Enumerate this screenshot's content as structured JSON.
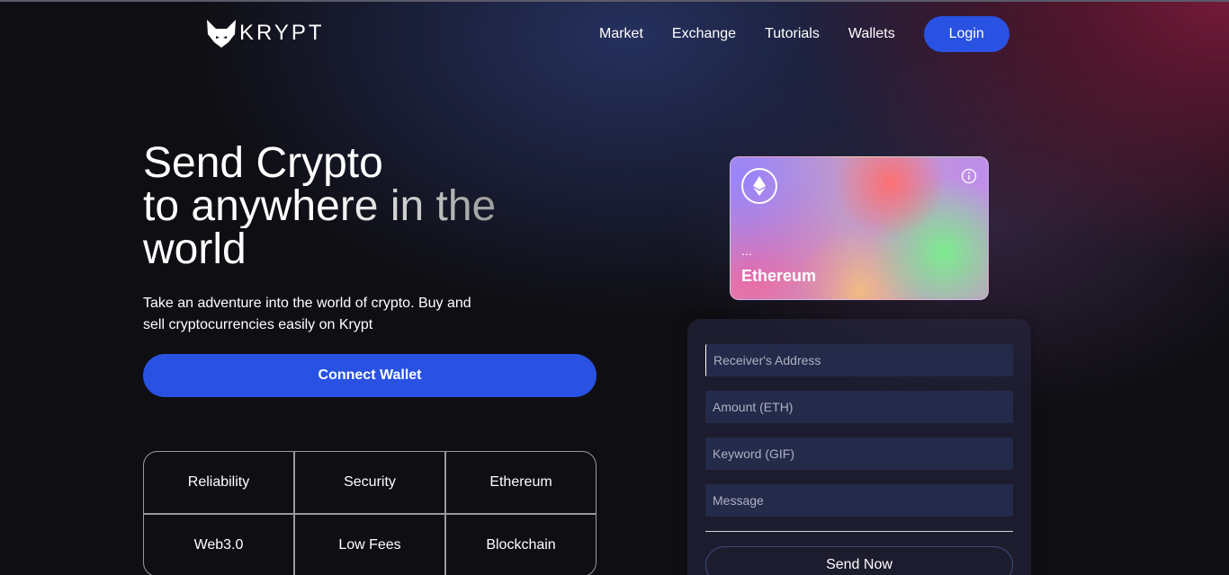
{
  "brand": {
    "name": "KRYPT"
  },
  "nav": {
    "items": [
      "Market",
      "Exchange",
      "Tutorials",
      "Wallets"
    ],
    "login_label": "Login"
  },
  "hero": {
    "title_line1": "Send Crypto",
    "title_line2": "to anywhere in the",
    "title_line3": "world",
    "subtitle": "Take an adventure into the world of crypto. Buy and sell cryptocurrencies easily on Krypt",
    "connect_label": "Connect Wallet"
  },
  "features": [
    "Reliability",
    "Security",
    "Ethereum",
    "Web3.0",
    "Low Fees",
    "Blockchain"
  ],
  "card": {
    "address": "...",
    "network": "Ethereum",
    "eth_icon": "ethereum-icon",
    "info_icon": "info-icon"
  },
  "form": {
    "receiver_placeholder": "Receiver's Address",
    "amount_placeholder": "Amount (ETH)",
    "keyword_placeholder": "Keyword (GIF)",
    "message_placeholder": "Message",
    "send_label": "Send Now"
  },
  "colors": {
    "accent": "#2952e3",
    "background": "#0f0e13",
    "input_bg": "#242a4a"
  }
}
